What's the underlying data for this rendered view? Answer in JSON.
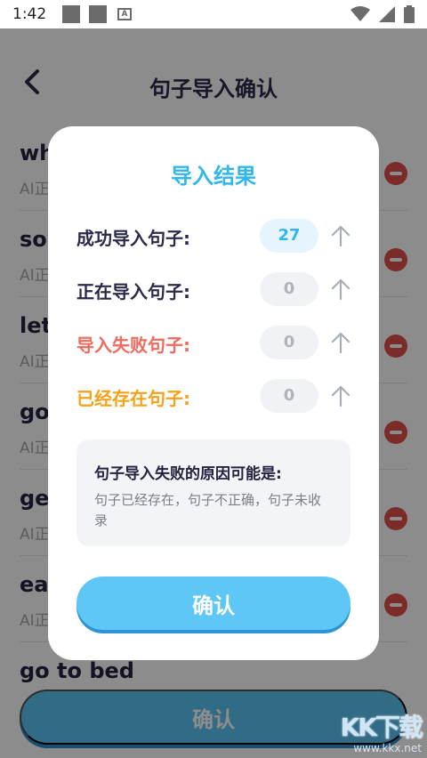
{
  "status_bar": {
    "time": "1:42",
    "notif_badge": "A"
  },
  "header": {
    "title": "句子导入确认"
  },
  "list_items": [
    {
      "word": "wh",
      "sub": "AI正"
    },
    {
      "word": "sou",
      "sub": "AI正"
    },
    {
      "word": "let",
      "sub": "AI正"
    },
    {
      "word": "go",
      "sub": "AI正"
    },
    {
      "word": "get",
      "sub": "AI正"
    },
    {
      "word": "eat",
      "sub": "AI正"
    },
    {
      "word": "go to bed",
      "sub": ""
    }
  ],
  "bottom_button": {
    "label": "确认"
  },
  "dialog": {
    "title": "导入结果",
    "rows": [
      {
        "label": "成功导入句子:",
        "count": "27",
        "color": "#2a2a4a"
      },
      {
        "label": "正在导入句子:",
        "count": "0",
        "color": "#2a2a4a"
      },
      {
        "label": "导入失败句子:",
        "count": "0",
        "color": "#f06a5e"
      },
      {
        "label": "已经存在句子:",
        "count": "0",
        "color": "#f5a21a"
      }
    ],
    "reason_title": "句子导入失败的原因可能是:",
    "reason_text": "句子已经存在，句子不正确，句子未收录",
    "confirm_label": "确认"
  },
  "watermark": {
    "main": "KK下载",
    "url": "www.kkx.net"
  },
  "colors": {
    "accent": "#33b6ec",
    "button": "#5ec7f6",
    "remove": "#e2504a"
  }
}
